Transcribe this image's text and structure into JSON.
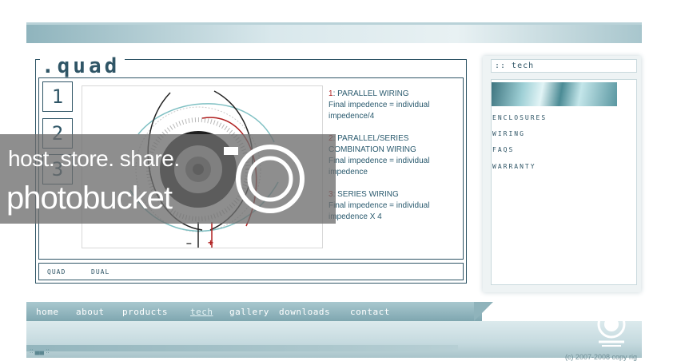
{
  "brand": {
    "title": ".quad"
  },
  "steps": [
    {
      "label": "1"
    },
    {
      "label": "2"
    },
    {
      "label": "3"
    }
  ],
  "wiring": [
    {
      "num": "1",
      "title": ": PARALLEL WIRING",
      "desc": "Final impedence = individual impedence/4"
    },
    {
      "num": "2",
      "title": ": PARALLEL/SERIES COMBINATION WIRING",
      "desc": "Final impedence = individual impedence"
    },
    {
      "num": "3",
      "title": ": SERIES WIRING",
      "desc": "Final impedence = individual impedence X 4"
    }
  ],
  "diagram": {
    "minus": "–",
    "plus": "+"
  },
  "sub_tabs": {
    "quad": "QUAD",
    "dual": "DUAL"
  },
  "side": {
    "header": ":: tech",
    "links": {
      "enclosures": "ENCLOSURES",
      "wiring": "WIRING",
      "faqs": "FAQS",
      "warranty": "WARRANTY"
    }
  },
  "nav": {
    "home": "home",
    "about": "about",
    "products": "products",
    "tech": "tech",
    "gallery": "gallery",
    "downloads": "downloads",
    "contact": "contact",
    "active": "tech"
  },
  "footer": {
    "dots": "::  ▄▄  ::",
    "copyright": "(c) 2007-2008 copy rig"
  },
  "watermark": {
    "line1": "host. store. share.",
    "line2": "photobucket"
  },
  "colors": {
    "accent": "#2f5566",
    "wire_red": "#b02020",
    "nav": "#7fa7b0"
  },
  "icons": {
    "logo": "circle-logo-icon",
    "watermark": "camera-lens-icon"
  }
}
